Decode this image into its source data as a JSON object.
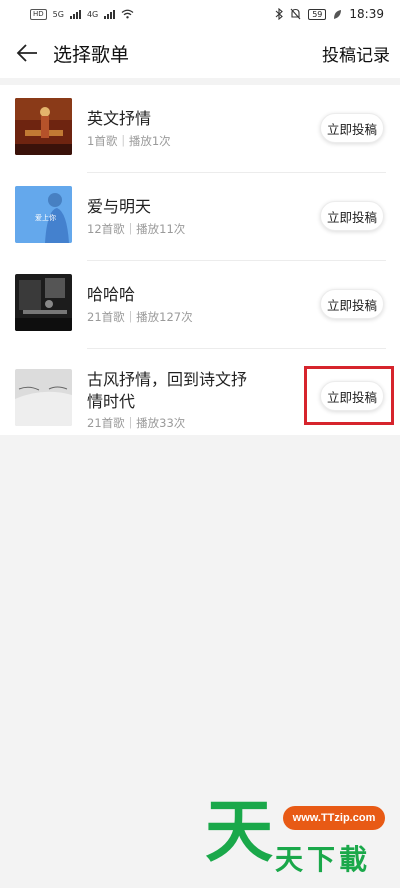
{
  "status_bar": {
    "hd1": "HD",
    "hd2": "HD",
    "net1": "5G",
    "net2": "4G",
    "battery": "59",
    "time": "18:39"
  },
  "header": {
    "title": "选择歌单",
    "record_label": "投稿记录"
  },
  "playlists": [
    {
      "name": "英文抒情",
      "meta": "1首歌｜播放1次",
      "submit_label": "立即投稿",
      "cover_color": "#7a2a14"
    },
    {
      "name": "爱与明天",
      "meta": "12首歌｜播放11次",
      "submit_label": "立即投稿",
      "cover_color": "#4a9ae6",
      "cover_text": "爱上你"
    },
    {
      "name": "哈哈哈",
      "meta": "21首歌｜播放127次",
      "submit_label": "立即投稿",
      "cover_color": "#222222"
    },
    {
      "name": "古风抒情，回到诗文抒情时代",
      "meta": "21首歌｜播放33次",
      "submit_label": "立即投稿",
      "cover_color": "#d9d9d9"
    }
  ],
  "watermark": {
    "url": "www.TTzip.com",
    "big": "天",
    "small": "天下載"
  },
  "colors": {
    "highlight": "#d6242c",
    "watermark_green": "#1aa84a",
    "watermark_orange": "#e85a15"
  }
}
